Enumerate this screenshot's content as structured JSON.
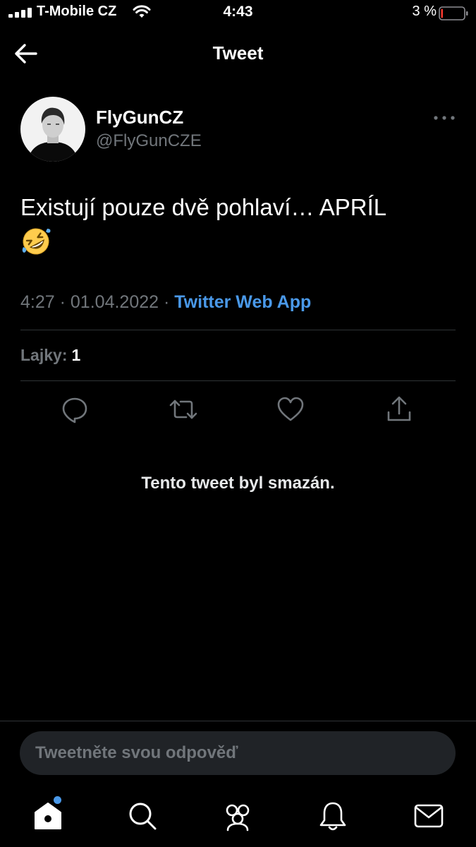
{
  "status_bar": {
    "carrier": "T-Mobile CZ",
    "time": "4:43",
    "battery_percent": "3 %",
    "battery_level": 0.03
  },
  "header": {
    "title": "Tweet",
    "back_icon": "back-arrow-icon"
  },
  "tweet": {
    "author_name": "FlyGunCZ",
    "author_handle": "@FlyGunCZE",
    "text": "Existují pouze dvě pohlaví… APRÍL",
    "emoji": "rolling-on-floor-laughing-emoji",
    "time": "4:27",
    "separator": "·",
    "date": "01.04.2022",
    "source": "Twitter Web App",
    "likes_label": "Lajky:",
    "likes_count": "1",
    "actions": [
      "reply-icon",
      "retweet-icon",
      "like-icon",
      "share-icon"
    ]
  },
  "deleted_notice": "Tento tweet byl smazán.",
  "reply": {
    "placeholder": "Tweetněte svou odpověď"
  },
  "tab_bar": {
    "items": [
      "home-icon",
      "search-icon",
      "communities-icon",
      "notifications-icon",
      "messages-icon"
    ],
    "home_has_notification_dot": true
  },
  "colors": {
    "background": "#000000",
    "link": "#4a99e9",
    "muted": "#71767b",
    "battery_low": "#ff3b30"
  }
}
